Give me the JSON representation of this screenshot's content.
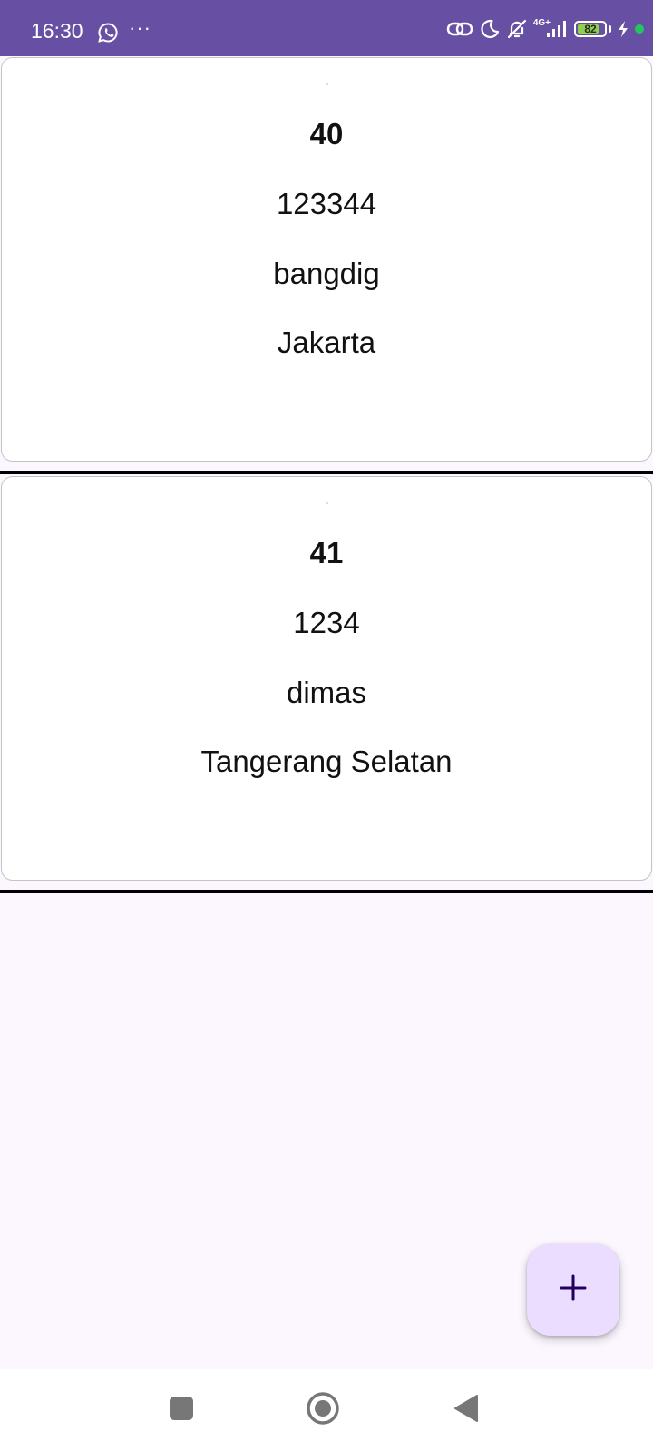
{
  "status_bar": {
    "time": "16:30",
    "overflow_dots": "···",
    "network_label": "4G+",
    "battery_level": "82",
    "battery_percent": 82,
    "background_color": "#6750a4"
  },
  "records": [
    {
      "id": "40",
      "number": "123344",
      "name": "bangdig",
      "city": "Jakarta"
    },
    {
      "id": "41",
      "number": "1234",
      "name": "dimas",
      "city": "Tangerang Selatan"
    }
  ],
  "fab": {
    "icon": "plus-icon",
    "color": "#eaddff"
  },
  "nav_bar": {
    "items": [
      "recents-icon",
      "home-icon",
      "back-icon"
    ]
  },
  "colors": {
    "page_background": "#fcf6ff",
    "card_background": "#ffffff",
    "divider": "#000000",
    "battery_fill": "#8fd14f",
    "charging_dot": "#22c55e"
  }
}
